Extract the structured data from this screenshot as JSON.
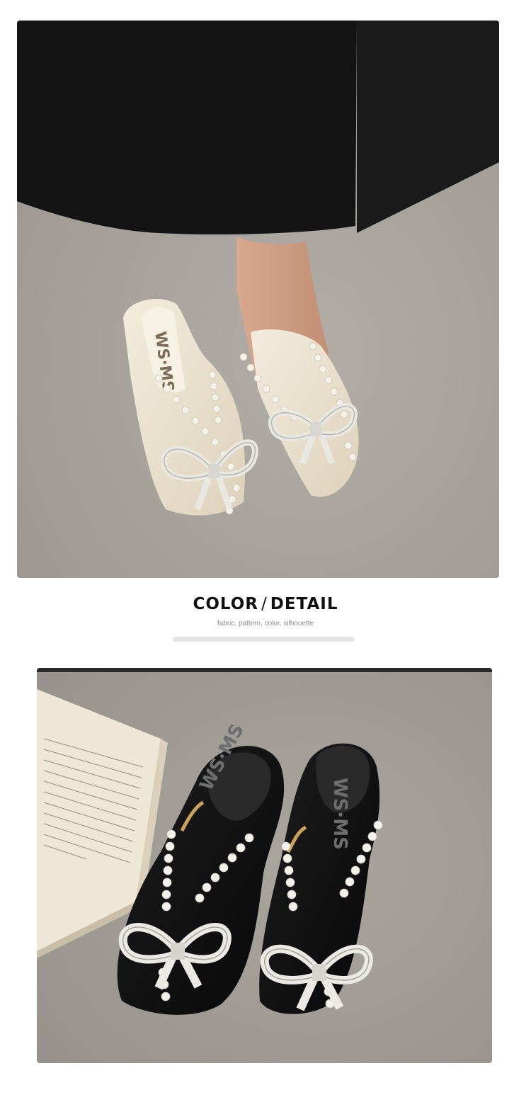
{
  "heading": {
    "title_part1": "COLOR",
    "title_separator": "/",
    "title_part2": "DETAIL",
    "subtitle": "fabric, pattern, color, silhouette"
  },
  "photos": {
    "top": {
      "insole_brand": "WS·MS"
    },
    "bottom": {
      "insole_brand": "WS·MS"
    }
  },
  "colors": {
    "floor": "#a49f99",
    "cream_shoe": "#ece4d2",
    "black_shoe": "#111111",
    "pearl": "#f4f1ea",
    "skirt": "#141414",
    "underline": "#e6e6e9"
  }
}
